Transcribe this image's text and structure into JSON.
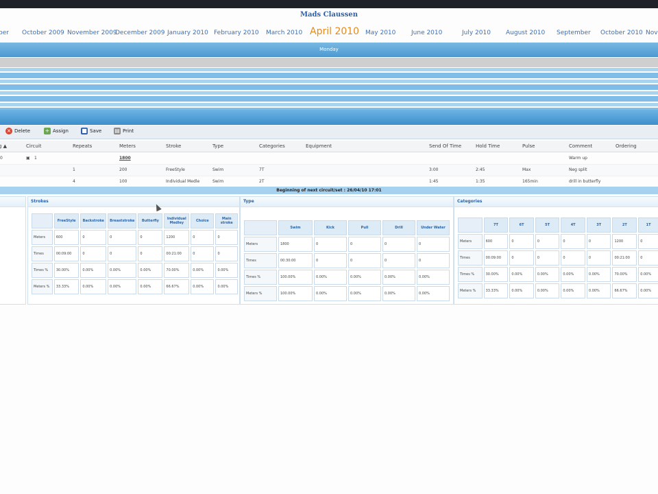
{
  "title": "Mads Claussen",
  "months": [
    "ber",
    "October 2009",
    "November 2009",
    "December 2009",
    "January 2010",
    "February 2010",
    "March 2010",
    "April 2010",
    "May 2010",
    "June 2010",
    "July 2010",
    "August 2010",
    "September",
    "October 2010",
    "Nov"
  ],
  "active_month": "April 2010",
  "day_label": "Monday",
  "toolbar": {
    "delete": "Delete",
    "assign": "Assign",
    "save": "Save",
    "print": "Print"
  },
  "grid": {
    "headers": [
      "g ▲",
      "Circuit",
      "Repeats",
      "Meters",
      "Stroke",
      "Type",
      "Categories",
      "Equipment",
      "Send Of Time",
      "Hold Time",
      "Pulse",
      "Comment",
      "Ordering"
    ],
    "rows": [
      {
        "c0": "0",
        "circuit": "1",
        "repeats": "",
        "meters": "1800",
        "stroke": "",
        "type": "",
        "categories": "",
        "send": "",
        "hold": "",
        "pulse": "",
        "comment": "Warm up"
      },
      {
        "c0": "",
        "circuit": "",
        "repeats": "1",
        "meters": "200",
        "stroke": "FreeStyle",
        "type": "Swim",
        "categories": "7T",
        "send": "3:00",
        "hold": "2:45",
        "pulse": "Max",
        "comment": "Neg split"
      },
      {
        "c0": "",
        "circuit": "",
        "repeats": "4",
        "meters": "100",
        "stroke": "Individual Medle",
        "type": "Swim",
        "categories": "2T",
        "send": "1:45",
        "hold": "1:35",
        "pulse": "165min",
        "comment": "drill in butterfly"
      }
    ]
  },
  "banner": "Beginning of next circuit/set : 26/04/10 17:01",
  "strokes_panel": {
    "title": "Strokes",
    "headers": [
      "",
      "FreeStyle",
      "Backstroke",
      "Breaststroke",
      "Butterfly",
      "Individual Medley",
      "Choice",
      "Main stroke"
    ],
    "rows": [
      [
        "Meters",
        "600",
        "0",
        "0",
        "0",
        "1200",
        "0",
        "0"
      ],
      [
        "Times",
        "00:09:00",
        "0",
        "0",
        "0",
        "00:21:00",
        "0",
        "0"
      ],
      [
        "Times %",
        "30.00%",
        "0.00%",
        "0.00%",
        "0.00%",
        "70.00%",
        "0.00%",
        "0.00%"
      ],
      [
        "Meters %",
        "33.33%",
        "0.00%",
        "0.00%",
        "0.00%",
        "66.67%",
        "0.00%",
        "0.00%"
      ]
    ]
  },
  "type_panel": {
    "title": "Type",
    "headers": [
      "",
      "Swim",
      "Kick",
      "Pull",
      "Drill",
      "Under Water"
    ],
    "rows": [
      [
        "Meters",
        "1800",
        "0",
        "0",
        "0",
        "0"
      ],
      [
        "Times",
        "00:30:00",
        "0",
        "0",
        "0",
        "0"
      ],
      [
        "Times %",
        "100.00%",
        "0.00%",
        "0.00%",
        "0.00%",
        "0.00%"
      ],
      [
        "Meters %",
        "100.00%",
        "0.00%",
        "0.00%",
        "0.00%",
        "0.00%"
      ]
    ]
  },
  "categories_panel": {
    "title": "Categories",
    "headers": [
      "",
      "7T",
      "6T",
      "5T",
      "4T",
      "3T",
      "2T",
      "1T"
    ],
    "rows": [
      [
        "Meters",
        "600",
        "0",
        "0",
        "0",
        "0",
        "1200",
        "0"
      ],
      [
        "Times",
        "00:09:00",
        "0",
        "0",
        "0",
        "0",
        "00:21:00",
        "0"
      ],
      [
        "Times %",
        "30.00%",
        "0.00%",
        "0.00%",
        "0.00%",
        "0.00%",
        "70.00%",
        "0.00%"
      ],
      [
        "Meters %",
        "33.33%",
        "0.00%",
        "0.00%",
        "0.00%",
        "0.00%",
        "66.67%",
        "0.00%"
      ]
    ]
  }
}
